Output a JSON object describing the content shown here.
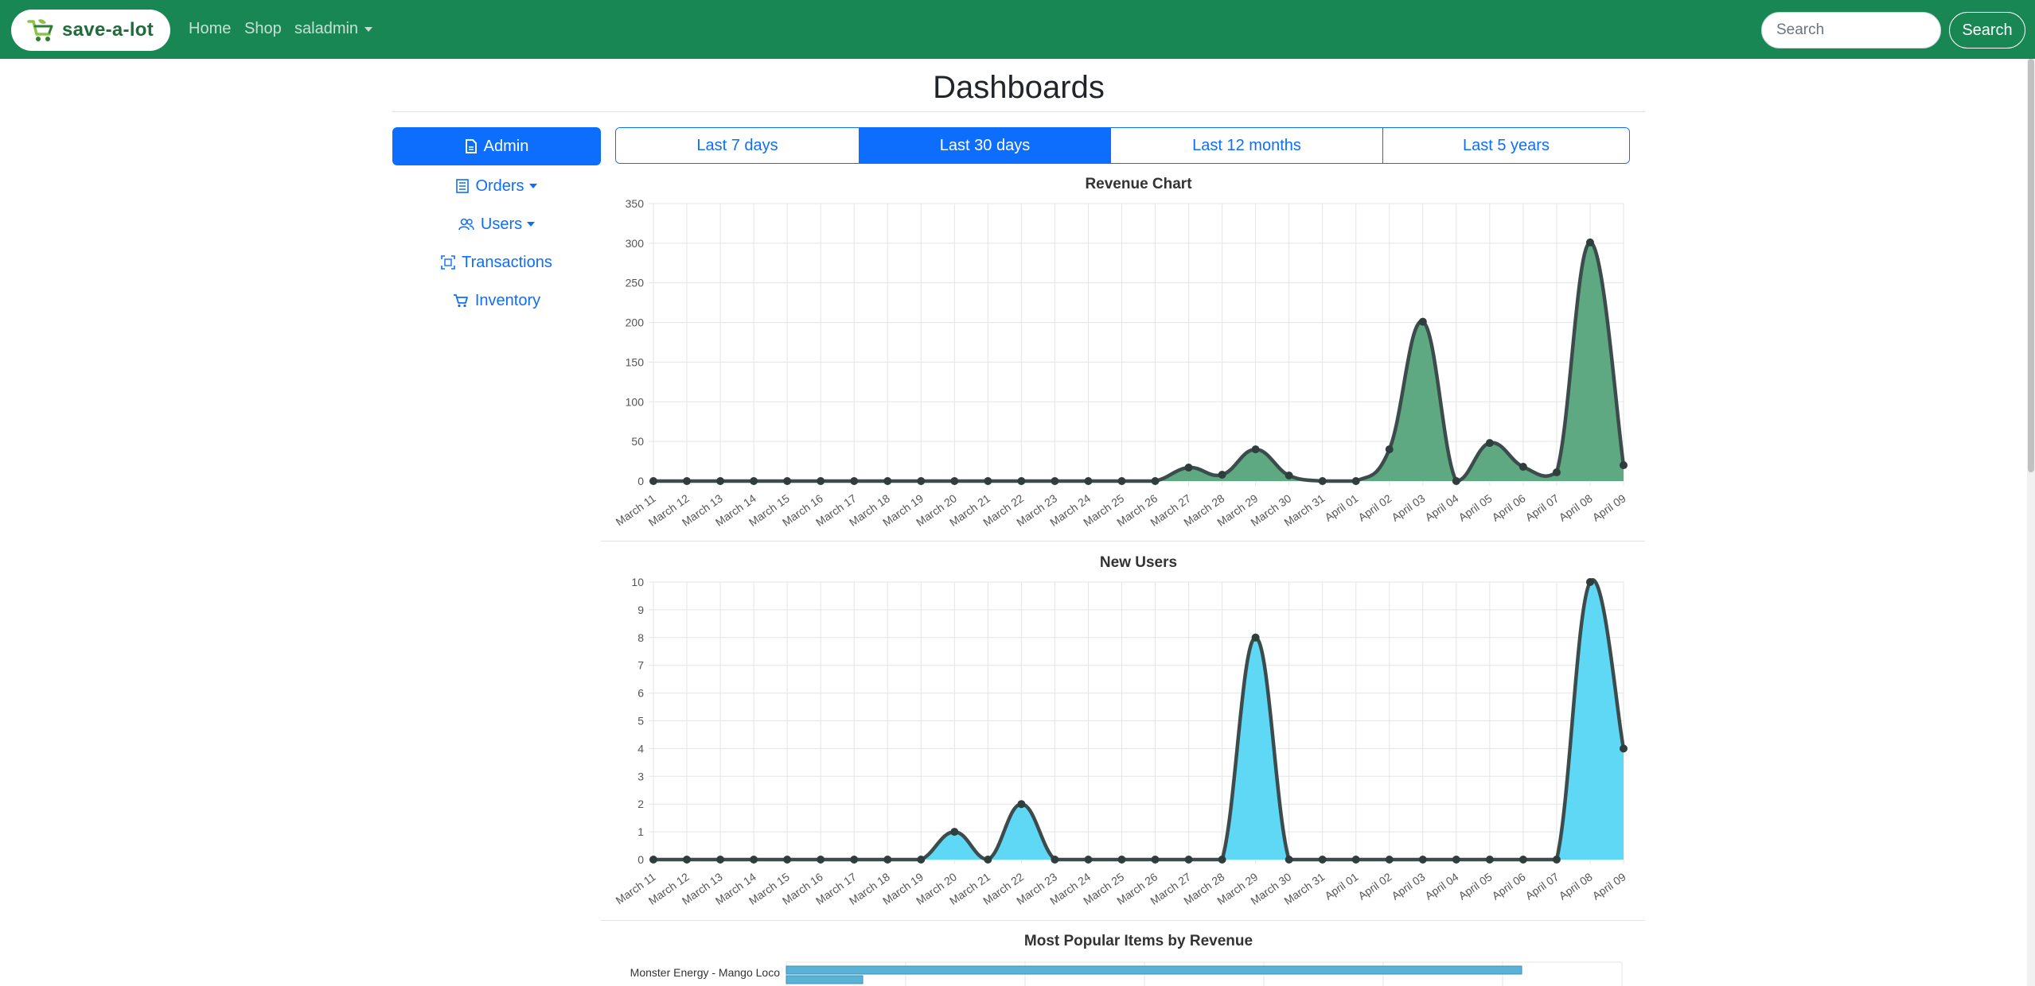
{
  "navbar": {
    "brand": "save-a-lot",
    "links": [
      "Home",
      "Shop",
      "saladmin"
    ],
    "search_placeholder": "Search",
    "search_button": "Search"
  },
  "page_title": "Dashboards",
  "sidebar": {
    "items": [
      {
        "label": "Admin",
        "icon": "document-icon"
      },
      {
        "label": "Orders",
        "icon": "list-icon"
      },
      {
        "label": "Users",
        "icon": "users-icon"
      },
      {
        "label": "Transactions",
        "icon": "transactions-icon"
      },
      {
        "label": "Inventory",
        "icon": "cart-icon"
      }
    ]
  },
  "range_tabs": [
    "Last 7 days",
    "Last 30 days",
    "Last 12 months",
    "Last 5 years"
  ],
  "colors": {
    "navbar": "#198754",
    "primary": "#0d6efd",
    "revenue_fill": "#5ea981",
    "users_fill": "#5fd8f5",
    "bar_fill": "#5ab3d6",
    "line": "#3c4c4c"
  },
  "chart_data": [
    {
      "type": "area",
      "title": "Revenue Chart",
      "categories": [
        "March 11",
        "March 12",
        "March 13",
        "March 14",
        "March 15",
        "March 16",
        "March 17",
        "March 18",
        "March 19",
        "March 20",
        "March 21",
        "March 22",
        "March 23",
        "March 24",
        "March 25",
        "March 26",
        "March 27",
        "March 28",
        "March 29",
        "March 30",
        "March 31",
        "April 01",
        "April 02",
        "April 03",
        "April 04",
        "April 05",
        "April 06",
        "April 07",
        "April 08",
        "April 09"
      ],
      "values": [
        0,
        0,
        0,
        0,
        0,
        0,
        0,
        0,
        0,
        0,
        0,
        0,
        0,
        0,
        0,
        0,
        17,
        8,
        40,
        7,
        0,
        0,
        40,
        201,
        0,
        48,
        18,
        11,
        301,
        20
      ],
      "ylim": [
        0,
        350
      ],
      "yticks": [
        0,
        50,
        100,
        150,
        200,
        250,
        300,
        350
      ],
      "grid": true
    },
    {
      "type": "area",
      "title": "New Users",
      "categories": [
        "March 11",
        "March 12",
        "March 13",
        "March 14",
        "March 15",
        "March 16",
        "March 17",
        "March 18",
        "March 19",
        "March 20",
        "March 21",
        "March 22",
        "March 23",
        "March 24",
        "March 25",
        "March 26",
        "March 27",
        "March 28",
        "March 29",
        "March 30",
        "March 31",
        "April 01",
        "April 02",
        "April 03",
        "April 04",
        "April 05",
        "April 06",
        "April 07",
        "April 08",
        "April 09"
      ],
      "values": [
        0,
        0,
        0,
        0,
        0,
        0,
        0,
        0,
        0,
        1,
        0,
        2,
        0,
        0,
        0,
        0,
        0,
        0,
        8,
        0,
        0,
        0,
        0,
        0,
        0,
        0,
        0,
        0,
        10,
        4
      ],
      "ylim": [
        0,
        10
      ],
      "yticks": [
        0,
        1,
        2,
        3,
        4,
        5,
        6,
        7,
        8,
        9,
        10
      ],
      "grid": true
    },
    {
      "type": "bar",
      "title": "Most Popular Items by Revenue",
      "categories": [
        "Monster Energy - Mango Loco"
      ],
      "values": [
        0.88
      ],
      "grid": true
    }
  ]
}
